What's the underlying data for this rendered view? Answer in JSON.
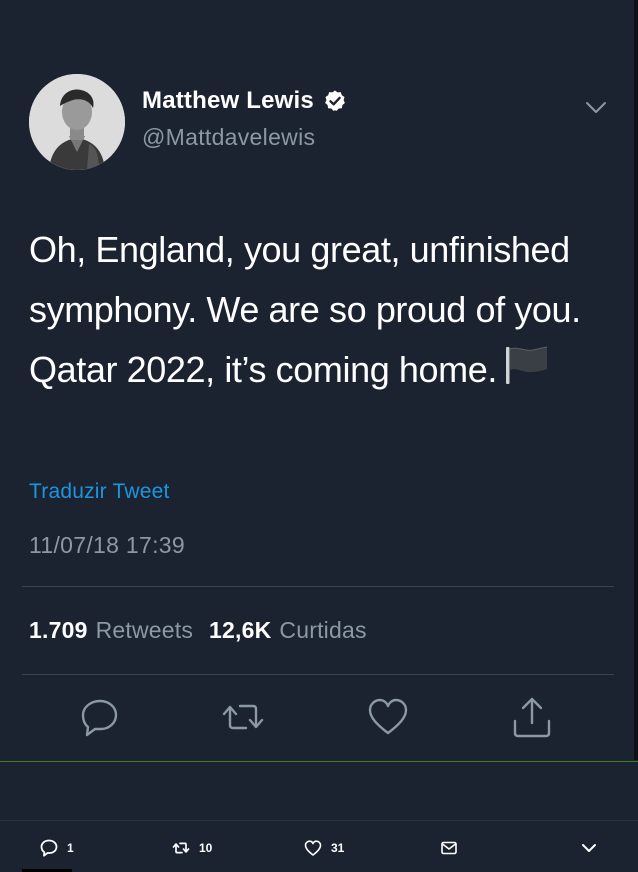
{
  "tweet": {
    "author": {
      "display_name": "Matthew Lewis",
      "handle": "@Mattdavelewis",
      "verified": true
    },
    "text": "Oh, England, you great, unfinished symphony. We are so proud of you. Qatar 2022, it’s coming home.",
    "emoji": "black-flag",
    "translate_label": "Traduzir Tweet",
    "timestamp": "11/07/18 17:39",
    "stats": {
      "retweets_count": "1.709",
      "retweets_label": "Retweets",
      "likes_count": "12,6K",
      "likes_label": "Curtidas"
    }
  },
  "actions": [
    "reply-icon",
    "retweet-icon",
    "like-icon",
    "share-icon"
  ],
  "bottom_bar": {
    "reply_count": "1",
    "retweet_count": "10",
    "like_count": "31"
  },
  "colors": {
    "background": "#1c2330",
    "link": "#1b95e0",
    "muted": "#8b98a5",
    "divider": "#38444d"
  }
}
